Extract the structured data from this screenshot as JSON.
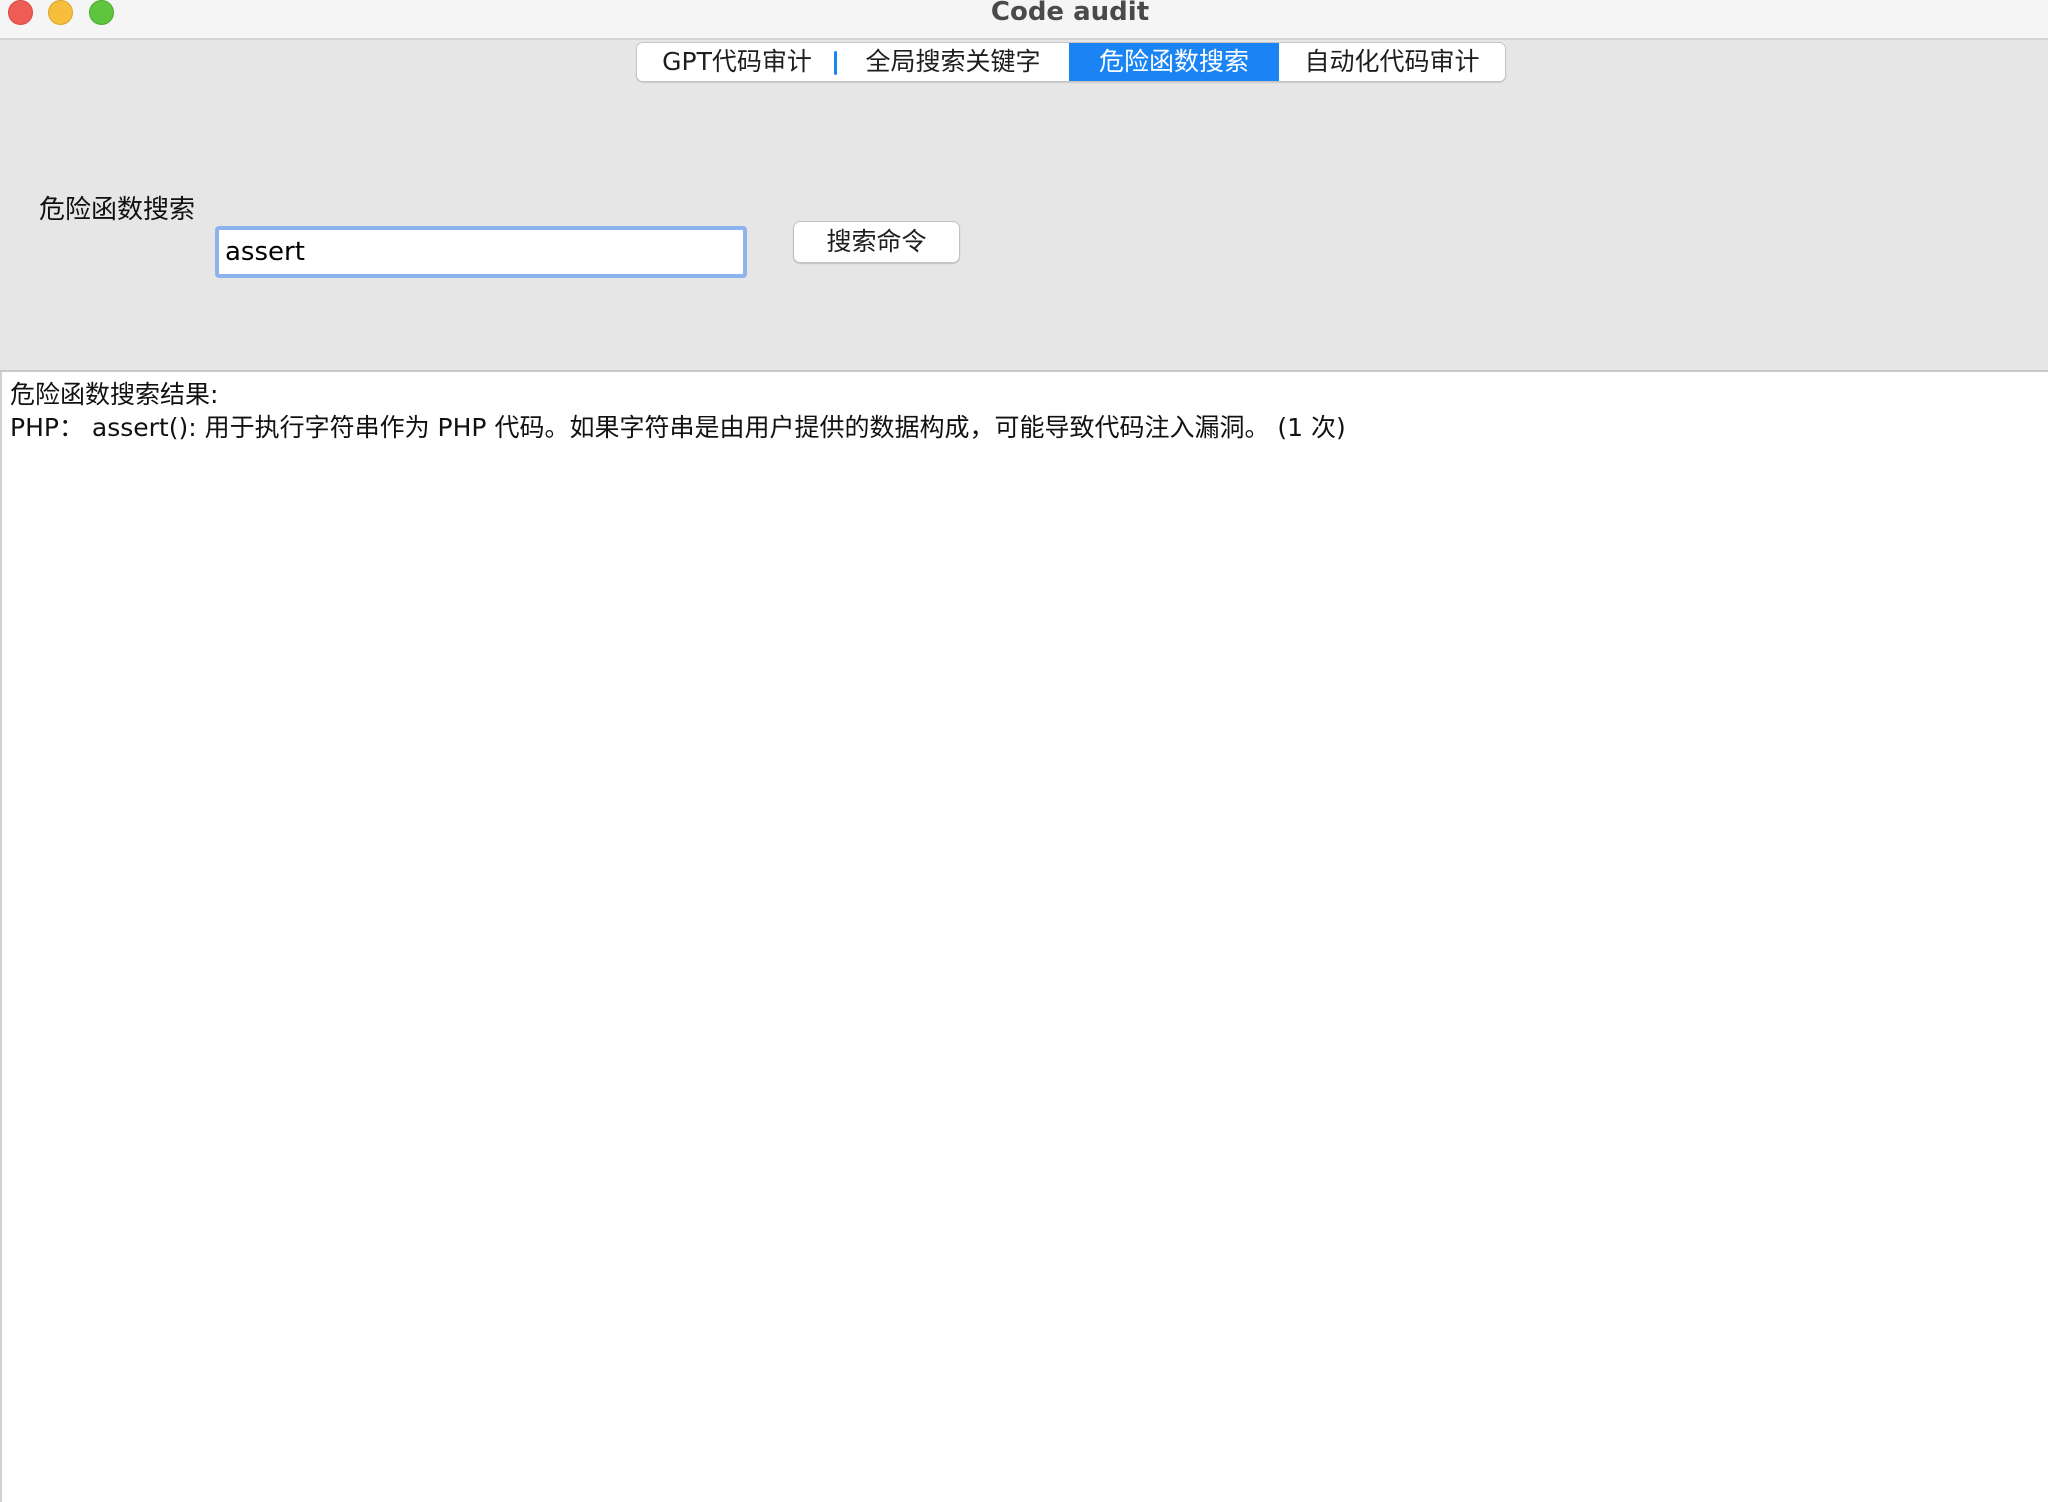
{
  "window": {
    "title": "Code audit"
  },
  "tabs": [
    {
      "label": "GPT代码审计",
      "selected": false
    },
    {
      "label": "全局搜索关键字",
      "selected": false
    },
    {
      "label": "危险函数搜索",
      "selected": true
    },
    {
      "label": "自动化代码审计",
      "selected": false
    }
  ],
  "search": {
    "label": "危险函数搜索",
    "value": "assert",
    "button_label": "搜索命令"
  },
  "results": {
    "heading": "危险函数搜索结果:",
    "lines": [
      "PHP： assert(): 用于执行字符串作为 PHP 代码。如果字符串是由用户提供的数据构成，可能导致代码注入漏洞。 (1 次)"
    ]
  },
  "colors": {
    "accent": "#1a84f4",
    "panel_bg": "#e6e6e6",
    "input_focus_ring": "#8cb3ec",
    "traffic_close": "#ee5e57",
    "traffic_minimize": "#f6be3b",
    "traffic_maximize": "#5fc53f"
  }
}
